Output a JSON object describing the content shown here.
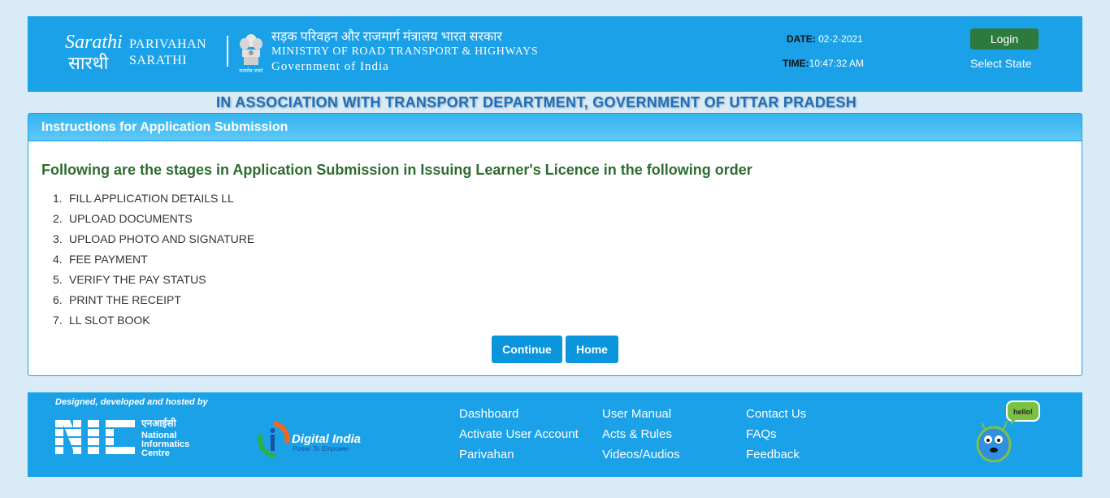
{
  "header": {
    "logo_text": "Sarathi",
    "brand_line1": "PARIVAHAN",
    "brand_line2": "SARATHI",
    "ministry_hindi": "सड़क परिवहन और राजमार्ग मंत्रालय भारत सरकार",
    "ministry_english": "MINISTRY OF ROAD TRANSPORT & HIGHWAYS",
    "government": "Government of India",
    "date_label": "DATE:",
    "date_value": "02-2-2021",
    "time_label": "TIME:",
    "time_value": "10:47:32 AM",
    "login_label": "Login",
    "select_state_label": "Select State"
  },
  "association_text": "IN ASSOCIATION WITH TRANSPORT DEPARTMENT, GOVERNMENT OF UTTAR PRADESH",
  "panel": {
    "title": "Instructions for Application Submission",
    "stages_heading": "Following are the stages in Application Submission in Issuing Learner's Licence in the following order",
    "steps": [
      {
        "num": "1.",
        "label": "FILL APPLICATION DETAILS LL"
      },
      {
        "num": "2.",
        "label": "UPLOAD DOCUMENTS"
      },
      {
        "num": "3.",
        "label": "UPLOAD PHOTO AND SIGNATURE"
      },
      {
        "num": "4.",
        "label": "FEE PAYMENT"
      },
      {
        "num": "5.",
        "label": "VERIFY THE PAY STATUS"
      },
      {
        "num": "6.",
        "label": "PRINT THE RECEIPT"
      },
      {
        "num": "7.",
        "label": "LL SLOT BOOK"
      }
    ],
    "continue_label": "Continue",
    "home_label": "Home"
  },
  "footer": {
    "designed_by": "Designed, developed and hosted by",
    "nic_hindi": "एनआईसी",
    "nic_name": [
      "National",
      "Informatics",
      "Centre"
    ],
    "digital_india": "Digital India",
    "digital_india_tagline": "Power To Empower",
    "links_col1": [
      "Dashboard",
      "Activate User Account",
      "Parivahan"
    ],
    "links_col2": [
      "User Manual",
      "Acts & Rules",
      "Videos/Audios"
    ],
    "links_col3": [
      "Contact Us",
      "FAQs",
      "Feedback"
    ],
    "mascot_bubble": "hello!"
  },
  "colors": {
    "header_blue": "#1aa1e8",
    "login_green": "#2e7a3e",
    "heading_green": "#2e6b30",
    "button_blue": "#0a95dc",
    "page_bg": "#d8ebf6"
  }
}
